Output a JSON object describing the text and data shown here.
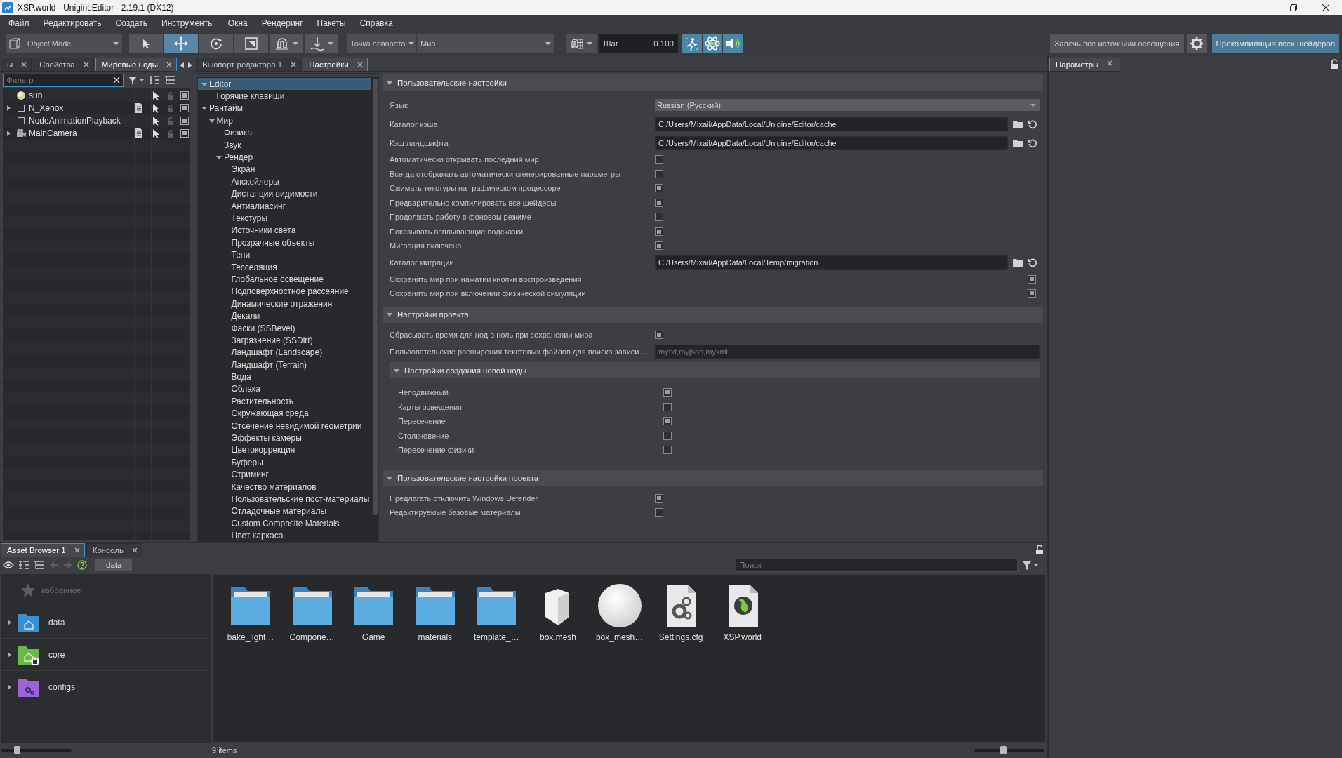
{
  "window": {
    "title": "XSP.world - UnigineEditor - 2.19.1 (DX12)"
  },
  "menu": [
    "Файл",
    "Редактировать",
    "Создать",
    "Инструменты",
    "Окна",
    "Рендеринг",
    "Пакеты",
    "Справка"
  ],
  "toolbar": {
    "mode": "Object Mode",
    "tools": [
      {
        "kind": "select",
        "selected": false
      },
      {
        "kind": "move",
        "selected": true
      },
      {
        "kind": "rotate",
        "selected": false
      },
      {
        "kind": "scale",
        "selected": false
      },
      {
        "kind": "snap",
        "selected": false
      },
      {
        "kind": "drop",
        "selected": false
      }
    ],
    "pivot": "Точка поворота",
    "space": "Мир",
    "step_label": "Шаг",
    "step": "0.100",
    "toggles": [
      {
        "kind": "effects",
        "on": true
      },
      {
        "kind": "physics",
        "on": true
      },
      {
        "kind": "sound",
        "on": true
      }
    ],
    "bake_button": "Запечь все источники освещения",
    "recompile_button": "Прекомпиляция всех шейдеров"
  },
  "nodes_panel": {
    "tabs": [
      {
        "label": "ы",
        "selected": false
      },
      {
        "label": "Свойства",
        "selected": false
      },
      {
        "label": "Мировые ноды",
        "selected": true
      }
    ],
    "filter_placeholder": "Фильтр",
    "nodes": [
      {
        "name": "sun",
        "kind": "light",
        "expandable": false,
        "script": false,
        "enabled": true
      },
      {
        "name": "N_Xenox",
        "kind": "node",
        "expandable": true,
        "script": true,
        "enabled": true
      },
      {
        "name": "NodeAnimationPlayback",
        "kind": "node",
        "expandable": false,
        "script": false,
        "enabled": true
      },
      {
        "name": "MainCamera",
        "kind": "camera",
        "expandable": true,
        "script": true,
        "enabled": true
      }
    ]
  },
  "settings_panel": {
    "tabs": [
      {
        "label": "Вьюпорт редактора 1",
        "selected": false
      },
      {
        "label": "Настройки",
        "selected": true
      }
    ],
    "tree": [
      {
        "label": "Editor",
        "selected": true,
        "expanded": true,
        "children": [
          {
            "label": "Горячие клавиши",
            "selected": false
          }
        ]
      },
      {
        "label": "Рантайм",
        "selected": false,
        "expanded": true,
        "children": [
          {
            "label": "Мир",
            "selected": false,
            "expanded": true,
            "children": [
              {
                "label": "Физика",
                "selected": false
              },
              {
                "label": "Звук",
                "selected": false
              },
              {
                "label": "Рендер",
                "selected": false,
                "expanded": true,
                "children": [
                  {
                    "label": "Экран",
                    "selected": false
                  },
                  {
                    "label": "Апскейлеры",
                    "selected": false
                  },
                  {
                    "label": "Дистанции видимости",
                    "selected": false
                  },
                  {
                    "label": "Антиалиасинг",
                    "selected": false
                  },
                  {
                    "label": "Текстуры",
                    "selected": false
                  },
                  {
                    "label": "Источники света",
                    "selected": false
                  },
                  {
                    "label": "Прозрачные объекты",
                    "selected": false
                  },
                  {
                    "label": "Тени",
                    "selected": false
                  },
                  {
                    "label": "Тесселяция",
                    "selected": false
                  },
                  {
                    "label": "Глобальное освещение",
                    "selected": false
                  },
                  {
                    "label": "Подповерхностное рассеяние",
                    "selected": false
                  },
                  {
                    "label": "Динамические отражения",
                    "selected": false
                  },
                  {
                    "label": "Декали",
                    "selected": false
                  },
                  {
                    "label": "Фаски (SSBevel)",
                    "selected": false
                  },
                  {
                    "label": "Загрязнение (SSDirt)",
                    "selected": false
                  },
                  {
                    "label": "Ландшафт (Landscape)",
                    "selected": false
                  },
                  {
                    "label": "Ландшафт (Terrain)",
                    "selected": false
                  },
                  {
                    "label": "Вода",
                    "selected": false
                  },
                  {
                    "label": "Облака",
                    "selected": false
                  },
                  {
                    "label": "Растительность",
                    "selected": false
                  },
                  {
                    "label": "Окружающая среда",
                    "selected": false
                  },
                  {
                    "label": "Отсечение невидимой геометрии",
                    "selected": false
                  },
                  {
                    "label": "Эффекты камеры",
                    "selected": false
                  },
                  {
                    "label": "Цветокоррекция",
                    "selected": false
                  },
                  {
                    "label": "Буферы",
                    "selected": false
                  },
                  {
                    "label": "Стриминг",
                    "selected": false
                  },
                  {
                    "label": "Качество материалов",
                    "selected": false
                  },
                  {
                    "label": "Пользовательские пост-материалы",
                    "selected": false
                  },
                  {
                    "label": "Отладочные материалы",
                    "selected": false
                  },
                  {
                    "label": "Custom Composite Materials",
                    "selected": false
                  },
                  {
                    "label": "Цвет каркаса",
                    "selected": false
                  }
                ]
              }
            ]
          }
        ]
      }
    ],
    "sections": [
      {
        "title": "Пользовательские настройки",
        "expanded": true,
        "rows": [
          {
            "kind": "dropdown",
            "label": "Язык",
            "value": "Russian (Русский)"
          },
          {
            "kind": "path",
            "label": "Каталог кэша",
            "value": "C:/Users/Mixail/AppData/Local/Unigine/Editor/cache"
          },
          {
            "kind": "path",
            "label": "Кэш ландшафта",
            "value": "C:/Users/Mixail/AppData/Local/Unigine/Editor/cache"
          },
          {
            "kind": "checkbox",
            "label": "Автоматически открывать последний мир",
            "checked": false
          },
          {
            "kind": "checkbox",
            "label": "Всегда отображать автоматически сгенерированные параметры",
            "checked": false
          },
          {
            "kind": "checkbox",
            "label": "Сжимать текстуры на графическом процессоре",
            "checked": true
          },
          {
            "kind": "checkbox",
            "label": "Предварительно компилировать все шейдеры",
            "checked": true
          },
          {
            "kind": "checkbox",
            "label": "Продолжать работу в фоновом режиме",
            "checked": false
          },
          {
            "kind": "checkbox",
            "label": "Показывать всплывающие подсказки",
            "checked": true
          },
          {
            "kind": "checkbox",
            "label": "Миграция включена",
            "checked": true
          },
          {
            "kind": "path",
            "label": "Каталог миграции",
            "value": "C:/Users/Mixail/AppData/Local/Temp/migration"
          },
          {
            "kind": "checkbox_end",
            "label": "Сохранять мир при нажатии кнопки воспроизведения",
            "checked": true
          },
          {
            "kind": "checkbox_end",
            "label": "Сохранять мир при включении физической симуляции",
            "checked": true
          }
        ]
      },
      {
        "title": "Настройки проекта",
        "expanded": true,
        "rows": [
          {
            "kind": "checkbox",
            "label": "Сбрасывать время для нод в ноль при сохранении мира",
            "checked": true
          },
          {
            "kind": "text",
            "label": "Пользовательские расширения текстовых файлов для поиска зависи…",
            "placeholder": "mytxt,myjson,myxml,..."
          },
          {
            "kind": "subsection",
            "title": "Настройки создания новой ноды",
            "expanded": true,
            "rows": [
              {
                "kind": "checkbox",
                "label": "Неподвижный",
                "checked": true
              },
              {
                "kind": "checkbox",
                "label": "Карты освещения",
                "checked": false
              },
              {
                "kind": "checkbox",
                "label": "Пересечение",
                "checked": true
              },
              {
                "kind": "checkbox",
                "label": "Столкновение",
                "checked": false
              },
              {
                "kind": "checkbox",
                "label": "Пересечение физики",
                "checked": false
              }
            ]
          }
        ]
      },
      {
        "title": "Пользовательские настройки проекта",
        "expanded": true,
        "rows": [
          {
            "kind": "checkbox",
            "label": "Предлагать отключить Windows Defender",
            "checked": true
          },
          {
            "kind": "checkbox",
            "label": "Редактируемые базовые материалы",
            "checked": false
          }
        ]
      }
    ]
  },
  "params_panel": {
    "tabs": [
      {
        "label": "Параметры",
        "selected": true
      }
    ]
  },
  "asset_browser": {
    "tabs": [
      {
        "label": "Asset Browser 1",
        "selected": true
      },
      {
        "label": "Консоль",
        "selected": false
      }
    ],
    "nav": [
      {
        "kind": "back",
        "disabled": true
      },
      {
        "kind": "forward",
        "disabled": true
      }
    ],
    "path": "data",
    "search_placeholder": "Поиск",
    "favorites": "избранное",
    "roots": [
      {
        "name": "data",
        "kind": "home",
        "expanded": false
      },
      {
        "name": "core",
        "kind": "locked",
        "expanded": false
      },
      {
        "name": "configs",
        "kind": "config",
        "expanded": false
      }
    ],
    "items": [
      {
        "name": "bake_light…",
        "kind": "folder"
      },
      {
        "name": "Compone…",
        "kind": "folder"
      },
      {
        "name": "Game",
        "kind": "folder"
      },
      {
        "name": "materials",
        "kind": "folder"
      },
      {
        "name": "template_…",
        "kind": "folder"
      },
      {
        "name": "box.mesh",
        "kind": "mesh"
      },
      {
        "name": "box_mesh…",
        "kind": "sphere"
      },
      {
        "name": "Settings.cfg",
        "kind": "config"
      },
      {
        "name": "XSP.world",
        "kind": "world"
      }
    ],
    "count": "9 items",
    "left_slider": {
      "level": 0.22
    },
    "right_slider": {
      "level": 0.41
    }
  }
}
